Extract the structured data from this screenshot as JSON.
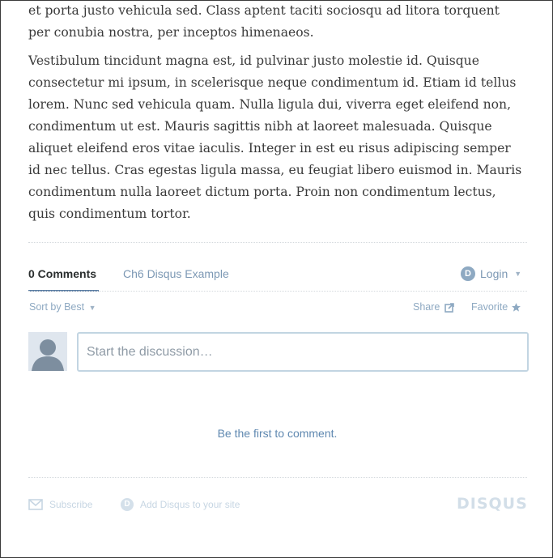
{
  "article": {
    "paragraph_1": "et porta justo vehicula sed. Class aptent taciti sociosqu ad litora torquent per conubia nostra, per inceptos himenaeos.",
    "paragraph_2": "Vestibulum tincidunt magna est, id pulvinar justo molestie id. Quisque consectetur mi ipsum, in scelerisque neque condimentum id. Etiam id tellus lorem. Nunc sed vehicula quam. Nulla ligula dui, viverra eget eleifend non, condimentum ut est. Mauris sagittis nibh at laoreet malesuada. Quisque aliquet eleifend eros vitae iaculis. Integer in est eu risus adipiscing semper id nec tellus. Cras egestas ligula massa, eu feugiat libero euismod in. Mauris condimentum nulla laoreet dictum porta. Proin non condimentum lectus, quis condimentum tortor."
  },
  "disqus": {
    "tabs": {
      "comments_label": "0 Comments",
      "forum_label": "Ch6 Disqus Example"
    },
    "login_label": "Login",
    "sort_label": "Sort by Best",
    "share_label": "Share",
    "favorite_label": "Favorite",
    "composer": {
      "placeholder": "Start the discussion…",
      "value": ""
    },
    "empty_message": "Be the first to comment.",
    "footer": {
      "subscribe_label": "Subscribe",
      "add_disqus_label": "Add Disqus to your site",
      "logo_text": "DISQUS"
    }
  },
  "icons": {
    "disqus_badge": "disqus-d-icon",
    "caret": "chevron-down-icon",
    "share": "share-icon",
    "favorite": "star-icon",
    "avatar": "user-avatar-icon",
    "subscribe": "envelope-icon",
    "add_disqus": "disqus-d-icon"
  },
  "colors": {
    "accent": "#5b7da3",
    "link": "#7c98b4",
    "muted": "#c7d6e3",
    "text": "#3a3a3a"
  }
}
